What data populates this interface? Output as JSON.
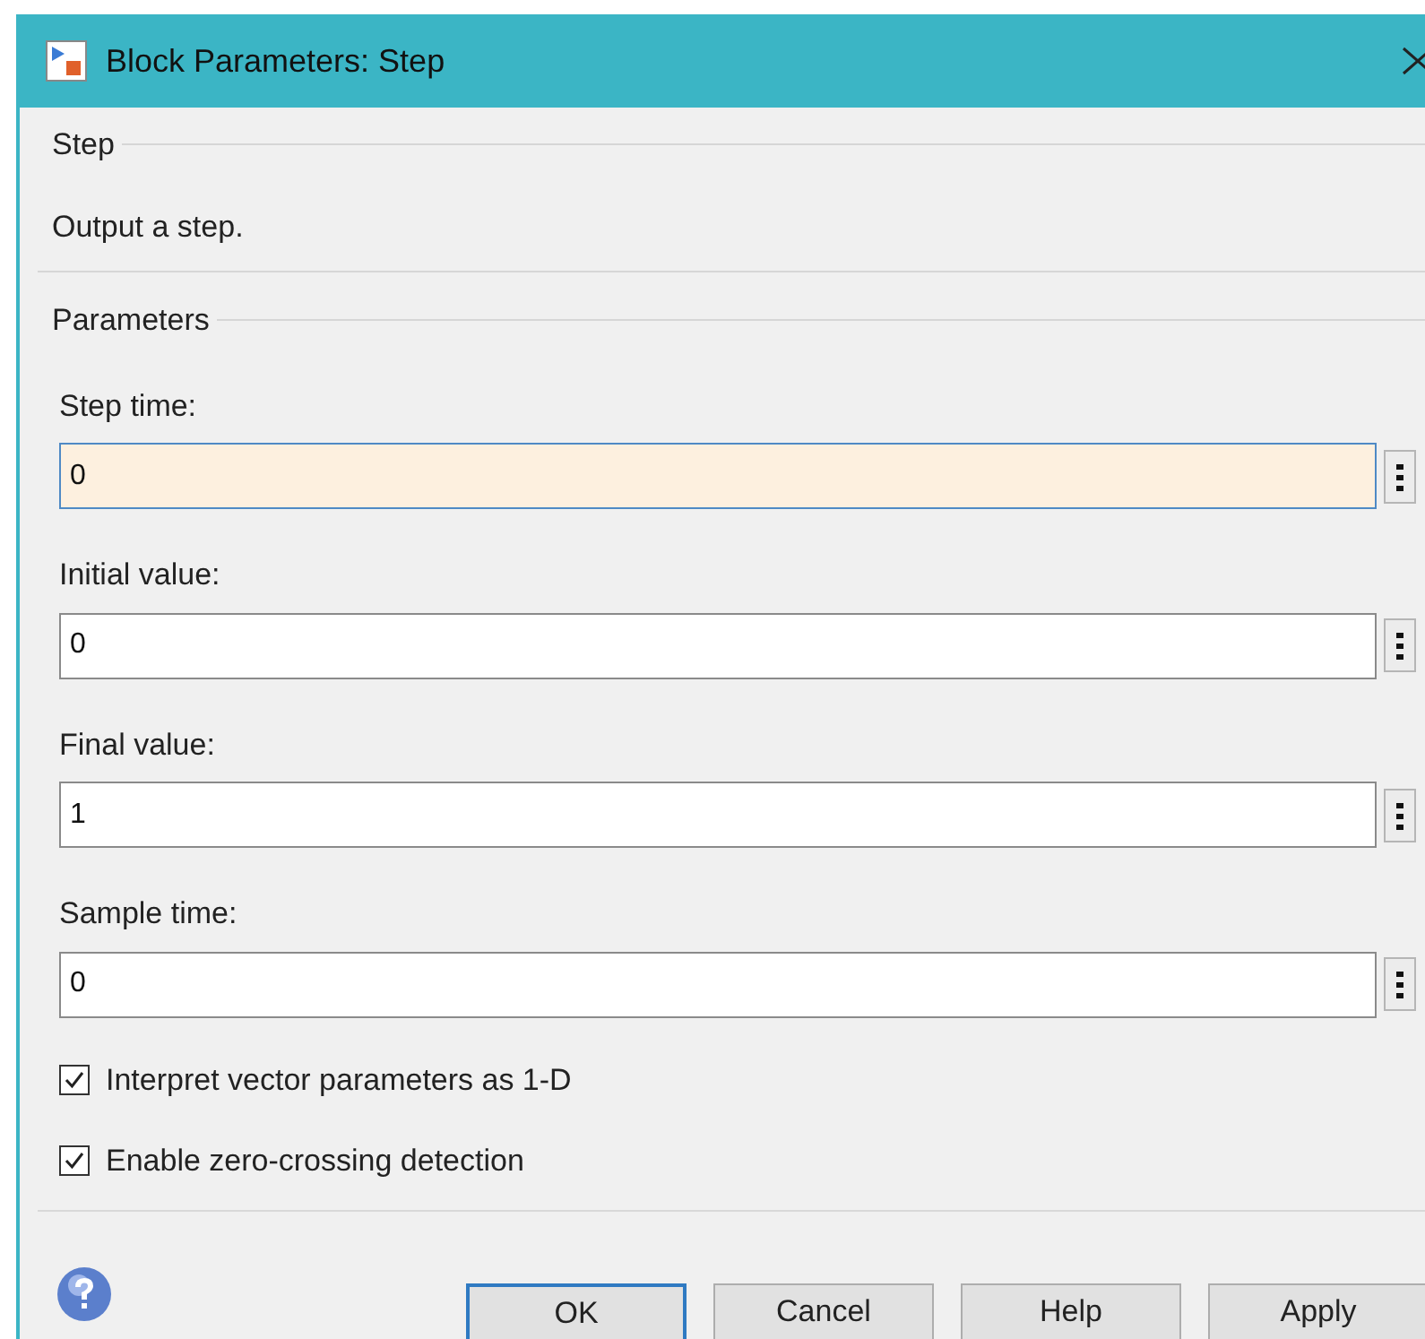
{
  "window": {
    "title": "Block Parameters: Step"
  },
  "block_group": {
    "label": "Step",
    "description": "Output a step."
  },
  "parameters_group": {
    "label": "Parameters"
  },
  "fields": [
    {
      "label": "Step time:",
      "value": "0",
      "focused": true
    },
    {
      "label": "Initial value:",
      "value": "0",
      "focused": false
    },
    {
      "label": "Final value:",
      "value": "1",
      "focused": false
    },
    {
      "label": "Sample time:",
      "value": "0",
      "focused": false
    }
  ],
  "checkboxes": [
    {
      "label": "Interpret vector parameters as 1-D",
      "checked": true
    },
    {
      "label": "Enable zero-crossing detection",
      "checked": true
    }
  ],
  "buttons": [
    {
      "label": "OK",
      "default": true
    },
    {
      "label": "Cancel",
      "default": false
    },
    {
      "label": "Help",
      "default": false
    },
    {
      "label": "Apply",
      "default": false
    }
  ]
}
